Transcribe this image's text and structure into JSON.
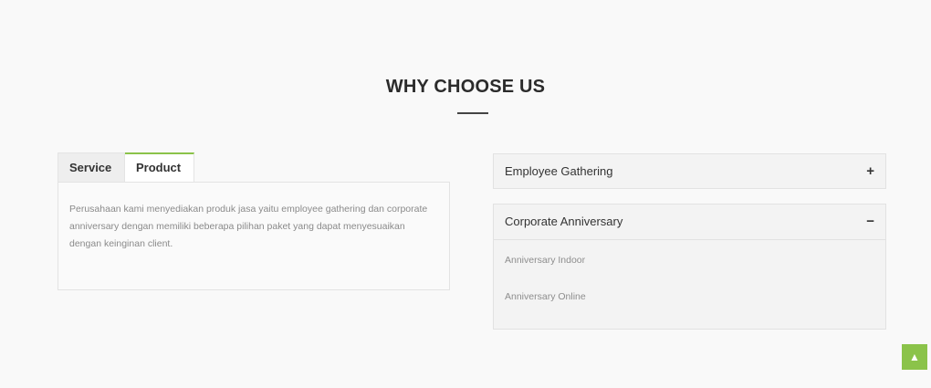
{
  "section": {
    "title": "WHY CHOOSE US"
  },
  "tabs": {
    "items": [
      {
        "label": "Service",
        "active": false
      },
      {
        "label": "Product",
        "active": true
      }
    ],
    "content": "Perusahaan kami menyediakan produk jasa yaitu employee gathering dan corporate anniversary dengan memiliki beberapa pilihan paket yang dapat menyesuaikan dengan keinginan client."
  },
  "accordion": {
    "items": [
      {
        "title": "Employee Gathering",
        "toggle": "+",
        "expanded": false
      },
      {
        "title": "Corporate Anniversary",
        "toggle": "−",
        "expanded": true,
        "links": [
          "Anniversary Indoor",
          "Anniversary Online"
        ]
      }
    ]
  },
  "back_to_top": {
    "icon": "chevron-up-icon",
    "glyph": "▲"
  },
  "colors": {
    "accent": "#8bc34a",
    "background": "#f9f9f9"
  }
}
